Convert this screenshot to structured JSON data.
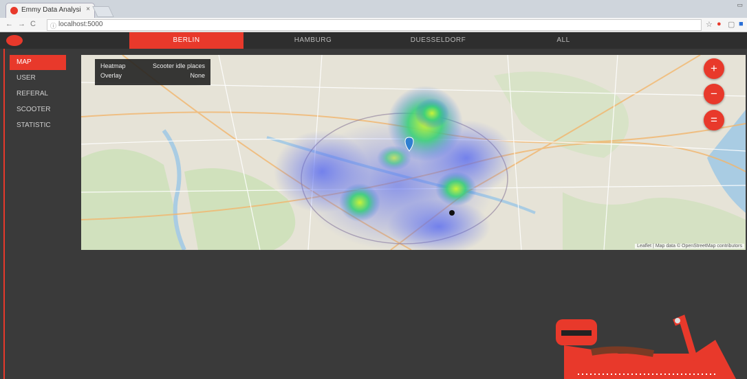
{
  "browser": {
    "tab_title": "Emmy Data Analysi",
    "tab_close": "×",
    "url": "localhost:5000",
    "nav": {
      "back": "←",
      "forward": "→",
      "reload": "C"
    }
  },
  "header": {
    "city_tabs": [
      {
        "label": "BERLIN",
        "active": true
      },
      {
        "label": "HAMBURG",
        "active": false
      },
      {
        "label": "DUESSELDORF",
        "active": false
      },
      {
        "label": "ALL",
        "active": false
      }
    ]
  },
  "sidebar": {
    "items": [
      {
        "label": "MAP",
        "active": true
      },
      {
        "label": "USER",
        "active": false
      },
      {
        "label": "REFERAL",
        "active": false
      },
      {
        "label": "SCOOTER",
        "active": false
      },
      {
        "label": "STATISTIC",
        "active": false
      }
    ]
  },
  "map": {
    "info": {
      "heatmap_key": "Heatmap",
      "heatmap_value": "Scooter idle places",
      "overlay_key": "Overlay",
      "overlay_value": "None"
    },
    "zoom_in": "+",
    "zoom_out": "−",
    "fit": "=",
    "attribution": "Leaflet | Map data © OpenStreetMap contributors"
  },
  "colors": {
    "accent": "#e8392b",
    "background": "#3a3a3a",
    "header": "#2e2e2e"
  }
}
